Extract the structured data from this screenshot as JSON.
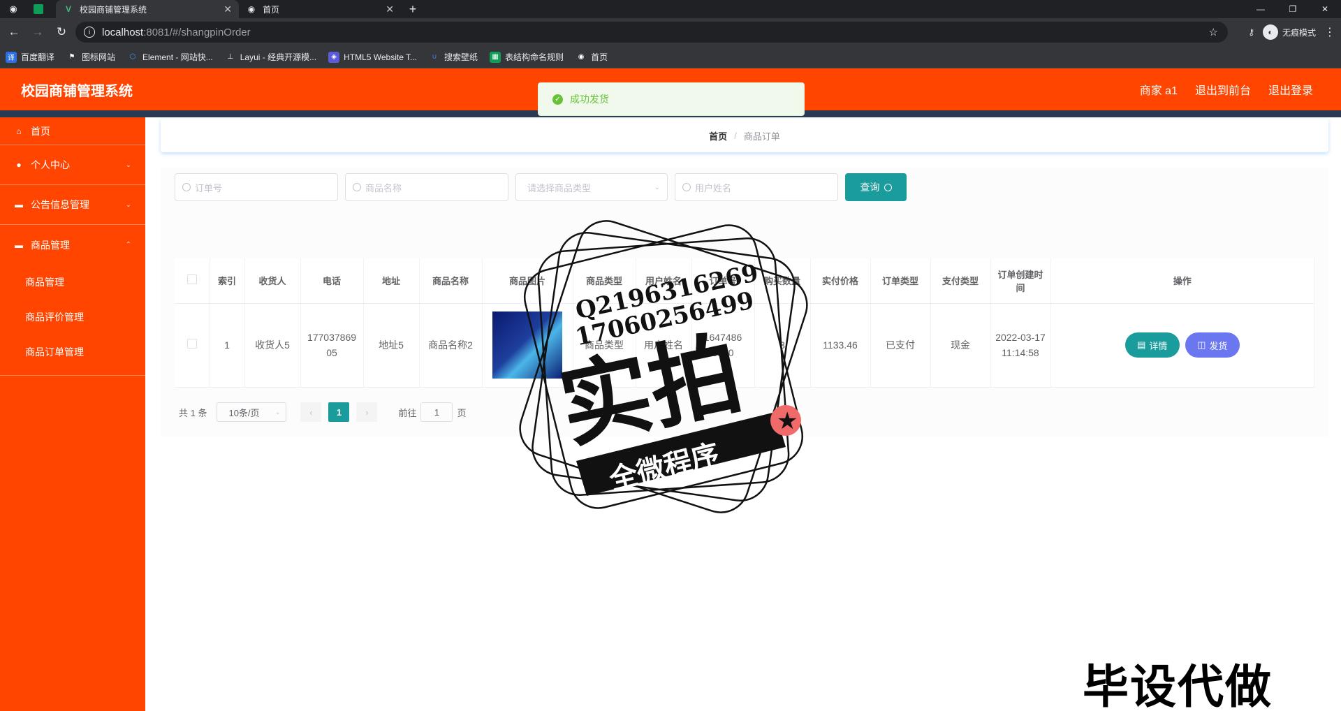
{
  "browser": {
    "tabs": [
      {
        "title": "校园商铺管理系统",
        "active": true
      },
      {
        "title": "首页",
        "active": false
      }
    ],
    "url_host": "localhost",
    "url_path": ":8081/#/shangpinOrder",
    "incognito_label": "无痕模式",
    "bookmarks": [
      {
        "label": "百度翻译",
        "icon": "translate-icon",
        "color": "#2b6fe0"
      },
      {
        "label": "图标网站",
        "icon": "flag-icon",
        "color": "#35363a"
      },
      {
        "label": "Element - 网站快...",
        "icon": "element-icon",
        "color": "#409eff"
      },
      {
        "label": "Layui - 经典开源模...",
        "icon": "layui-icon",
        "color": "#35363a"
      },
      {
        "label": "HTML5 Website T...",
        "icon": "html5-icon",
        "color": "#5b5bd6"
      },
      {
        "label": "搜索壁纸",
        "icon": "wallpaper-icon",
        "color": "#3b82f6"
      },
      {
        "label": "表结构命名规则",
        "icon": "sheet-icon",
        "color": "#0f9d58"
      },
      {
        "label": "首页",
        "icon": "globe-icon",
        "color": "#35363a"
      }
    ]
  },
  "header": {
    "title": "校园商铺管理系统",
    "user": "商家 a1",
    "to_front": "退出到前台",
    "logout": "退出登录"
  },
  "toast": {
    "message": "成功发货"
  },
  "sidebar": {
    "items": [
      {
        "label": "首页",
        "icon": "home-icon"
      },
      {
        "label": "个人中心",
        "icon": "user-icon"
      },
      {
        "label": "公告信息管理",
        "icon": "notice-icon"
      },
      {
        "label": "商品管理",
        "icon": "goods-icon"
      }
    ],
    "sub_items": [
      "商品管理",
      "商品评价管理",
      "商品订单管理"
    ]
  },
  "breadcrumb": {
    "home": "首页",
    "separator": "/",
    "current": "商品订单"
  },
  "search": {
    "order_no_placeholder": "订单号",
    "goods_name_placeholder": "商品名称",
    "goods_type_placeholder": "请选择商品类型",
    "user_name_placeholder": "用户姓名",
    "query_label": "查询"
  },
  "table": {
    "columns": [
      "索引",
      "收货人",
      "电话",
      "地址",
      "商品名称",
      "商品图片",
      "商品类型",
      "用户姓名",
      "订单号",
      "购买数量",
      "实付价格",
      "订单类型",
      "支付类型",
      "订单创建时间",
      "操作"
    ],
    "rows": [
      {
        "index": "1",
        "receiver": "收货人5",
        "phone": "17703786905",
        "address": "地址5",
        "goods_name": "商品名称2",
        "goods_type": "商品类型",
        "user_name": "用户姓名",
        "order_no": "1647486 8130",
        "quantity": "3",
        "price": "1133.46",
        "order_type": "已支付",
        "pay_type": "现金",
        "created": "2022-03-17 11:14:58"
      }
    ],
    "detail_label": "详情",
    "ship_label": "发货"
  },
  "pagination": {
    "total": "共 1 条",
    "page_size": "10条/页",
    "current_page": "1",
    "goto_prefix": "前往",
    "goto_value": "1",
    "goto_suffix": "页"
  },
  "watermark": {
    "qq": "Q2196316269",
    "phone": "17060256499",
    "big": "实拍",
    "ribbon": "全微程序",
    "corner": "毕设代做"
  }
}
